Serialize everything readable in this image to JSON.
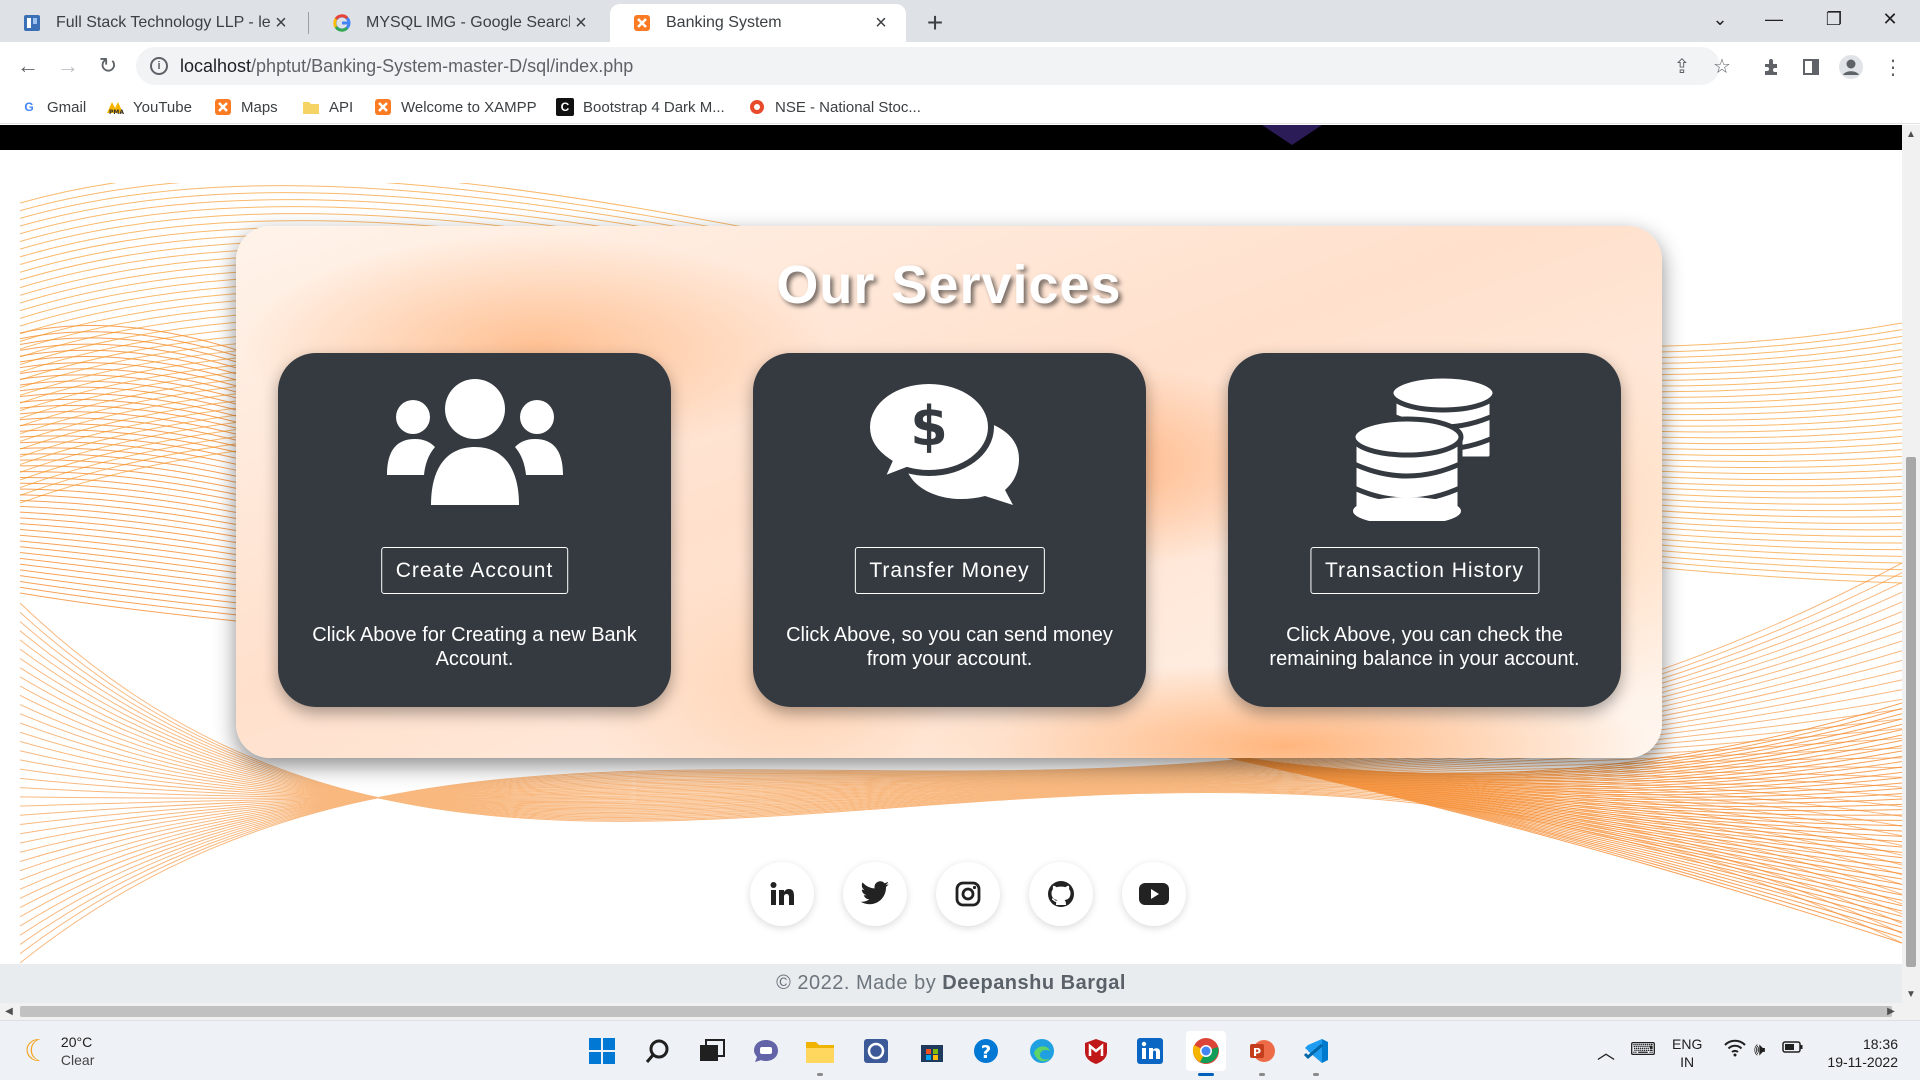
{
  "browser": {
    "tabs": [
      {
        "title": "Full Stack Technology LLP - leadi",
        "icon": "fst-favicon",
        "active": false
      },
      {
        "title": "MYSQL IMG - Google Search",
        "icon": "google-icon",
        "active": false
      },
      {
        "title": "Banking System",
        "icon": "xampp-icon",
        "active": true
      }
    ],
    "url_host": "localhost",
    "url_path": "/phptut/Banking-System-master-D/sql/index.php",
    "bookmarks": [
      {
        "label": "Gmail",
        "icon": "google-icon"
      },
      {
        "label": "YouTube",
        "icon": "youtube-icon"
      },
      {
        "label": "Maps",
        "icon": "xampp-icon"
      },
      {
        "label": "API",
        "icon": "folder-icon"
      },
      {
        "label": "Welcome to XAMPP",
        "icon": "xampp-icon"
      },
      {
        "label": "Bootstrap 4 Dark M...",
        "icon": "c-icon"
      },
      {
        "label": "NSE - National Stoc...",
        "icon": "nse-icon"
      }
    ]
  },
  "page": {
    "services_title": "Our Services",
    "cards": [
      {
        "icon": "users-icon",
        "button": "Create Account",
        "description": "Click Above for Creating a new Bank Account."
      },
      {
        "icon": "money-chat-icon",
        "button": "Transfer Money",
        "description": "Click Above, so you can send money from your account."
      },
      {
        "icon": "coins-icon",
        "button": "Transaction History",
        "description": "Click Above, you can check the remaining balance in your account."
      }
    ],
    "socials": [
      "linkedin-icon",
      "twitter-icon",
      "instagram-icon",
      "github-icon",
      "youtube-icon"
    ],
    "footer": {
      "prefix": "© 2022. Made by",
      "author": "Deepanshu Bargal"
    }
  },
  "taskbar": {
    "weather": {
      "temp": "20°C",
      "condition": "Clear"
    },
    "lang": {
      "line1": "ENG",
      "line2": "IN"
    },
    "time": "18:36",
    "date": "19-11-2022"
  },
  "colors": {
    "card_bg": "#343a40",
    "accent_wave": "#f5821f",
    "footer_bg": "#e9ecef"
  }
}
